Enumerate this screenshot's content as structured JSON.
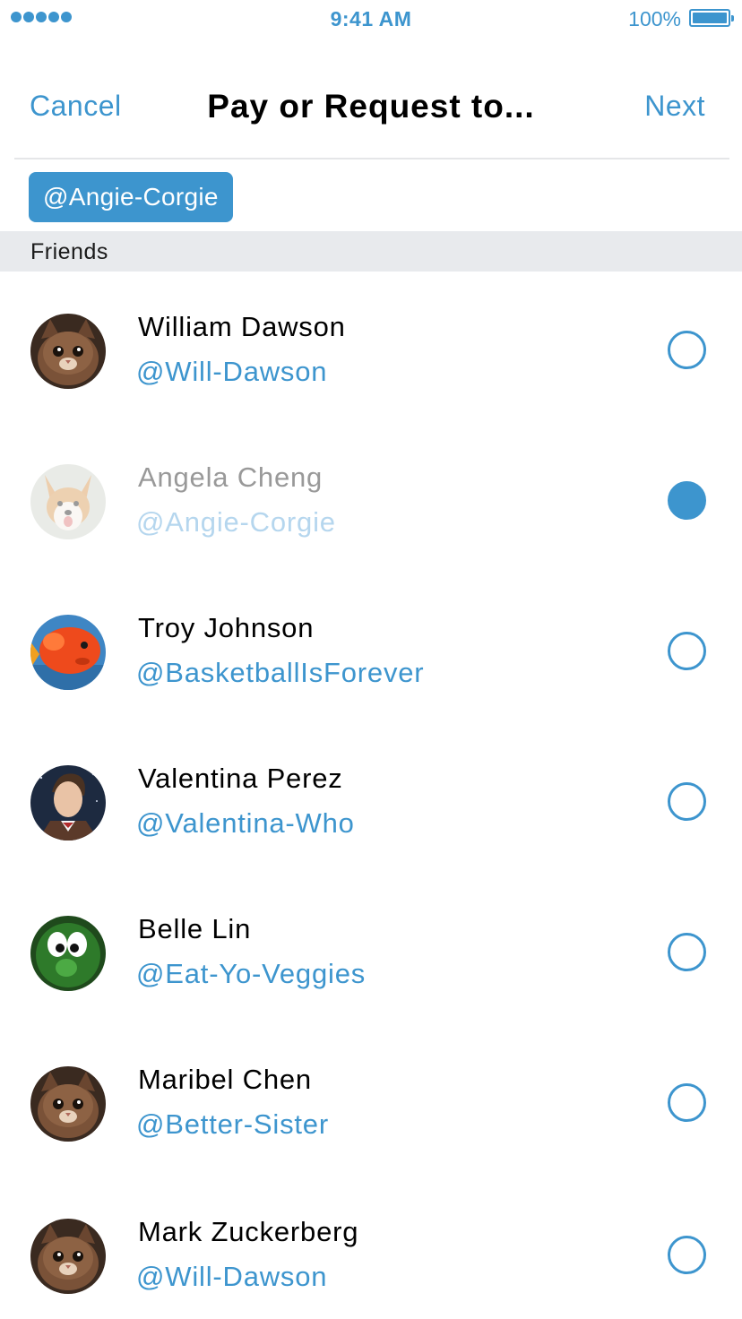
{
  "status_bar": {
    "time": "9:41 AM",
    "battery_percent": "100%",
    "signal_icon": "signal-dots-icon",
    "battery_icon": "battery-icon",
    "accent_color": "#3d95ce"
  },
  "nav": {
    "cancel_label": "Cancel",
    "title": "Pay or Request to...",
    "next_label": "Next"
  },
  "selected_chip": {
    "label": "@Angie-Corgie"
  },
  "section": {
    "header": "Friends"
  },
  "friends": [
    {
      "name": "William Dawson",
      "handle": "@Will-Dawson",
      "avatar": "cat-avatar",
      "selected": false
    },
    {
      "name": "Angela Cheng",
      "handle": "@Angie-Corgie",
      "avatar": "corgi-avatar",
      "selected": true
    },
    {
      "name": "Troy Johnson",
      "handle": "@BasketballIsForever",
      "avatar": "goldfish-avatar",
      "selected": false
    },
    {
      "name": "Valentina Perez",
      "handle": "@Valentina-Who",
      "avatar": "doctor-avatar",
      "selected": false
    },
    {
      "name": "Belle Lin",
      "handle": "@Eat-Yo-Veggies",
      "avatar": "cucumber-avatar",
      "selected": false
    },
    {
      "name": "Maribel Chen",
      "handle": "@Better-Sister",
      "avatar": "cat-avatar",
      "selected": false
    },
    {
      "name": "Mark Zuckerberg",
      "handle": "@Will-Dawson",
      "avatar": "cat-avatar",
      "selected": false
    }
  ]
}
